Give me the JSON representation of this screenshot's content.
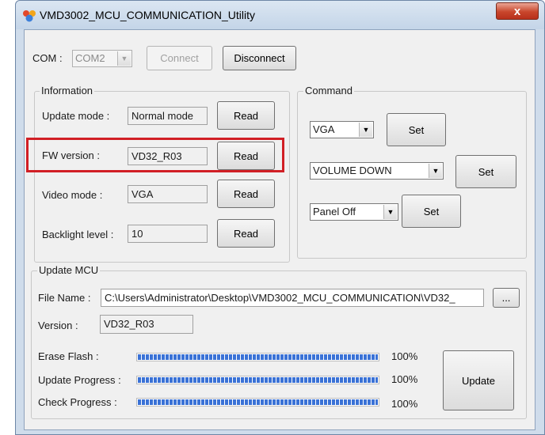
{
  "window": {
    "title": "VMD3002_MCU_COMMUNICATION_Utility",
    "close_label": "x"
  },
  "com": {
    "label": "COM :",
    "selected": "COM2",
    "connect_label": "Connect",
    "disconnect_label": "Disconnect"
  },
  "information": {
    "title": "Information",
    "rows": [
      {
        "label": "Update mode :",
        "value": "Normal mode",
        "button": "Read"
      },
      {
        "label": "FW version :",
        "value": "VD32_R03",
        "button": "Read"
      },
      {
        "label": "Video mode :",
        "value": "VGA",
        "button": "Read"
      },
      {
        "label": "Backlight level :",
        "value": "10",
        "button": "Read"
      }
    ]
  },
  "command": {
    "title": "Command",
    "rows": [
      {
        "selected": "VGA",
        "button": "Set"
      },
      {
        "selected": "VOLUME DOWN",
        "button": "Set"
      },
      {
        "selected": "Panel Off",
        "button": "Set"
      }
    ]
  },
  "update_mcu": {
    "title": "Update MCU",
    "file_label": "File Name :",
    "file_path": "C:\\Users\\Administrator\\Desktop\\VMD3002_MCU_COMMUNICATION\\VD32_",
    "browse_label": "...",
    "version_label": "Version :",
    "version_value": "VD32_R03",
    "progress": [
      {
        "label": "Erase Flash :",
        "percent_text": "100%",
        "value": 1.0
      },
      {
        "label": "Update Progress :",
        "percent_text": "100%",
        "value": 1.0
      },
      {
        "label": "Check Progress :",
        "percent_text": "100%",
        "value": 1.0
      }
    ],
    "update_label": "Update"
  },
  "colors": {
    "highlight": "#d11f25",
    "progress": "#3a72d6",
    "close_button": "#c9462c"
  }
}
